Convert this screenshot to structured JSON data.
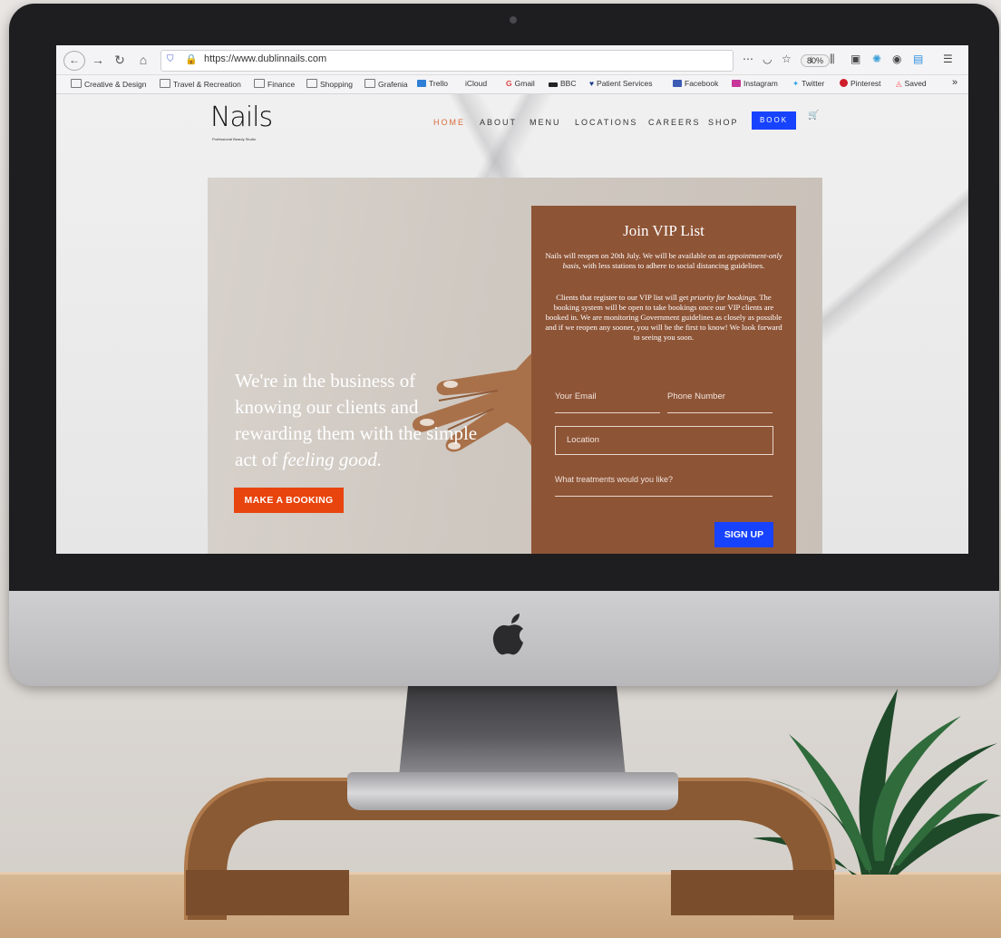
{
  "browser": {
    "url": "https://www.dublinnails.com",
    "zoom": "80%",
    "bookmarks": [
      "Creative & Design",
      "Travel & Recreation",
      "Finance",
      "Shopping",
      "Grafenia",
      "Trello",
      "iCloud",
      "Gmail",
      "BBC",
      "Patient Services",
      "Facebook",
      "Instagram",
      "Twitter",
      "Pinterest",
      "Saved"
    ]
  },
  "site": {
    "logo": "Nails",
    "logo_tagline": "Professional Beauty Studio",
    "nav": [
      "HOME",
      "ABOUT",
      "MENU",
      "LOCATIONS",
      "CAREERS",
      "SHOP"
    ],
    "book_label": "BOOK",
    "hero": {
      "headline_1": "We're in the business of knowing our clients and rewarding them with the simple act of",
      "headline_emph": "feeling good.",
      "cta": "MAKE A BOOKING"
    },
    "vip": {
      "title": "Join VIP List",
      "p1_a": "Nails will reopen on 20th July. We will be available on an",
      "p1_emph": "appointment-only basis,",
      "p1_b": "with less stations to adhere to social distancing guidelines.",
      "p2_a": "Clients that register to our VIP list will get",
      "p2_emph": "priority for bookings.",
      "p2_b": "The booking system will be open to take bookings once our VIP clients are booked in. We are monitoring Government guidelines as closely as possible and if we reopen any sooner, you will be the first to know! We look forward to seeing you soon.",
      "email_placeholder": "Your Email",
      "phone_placeholder": "Phone Number",
      "location_placeholder": "Location",
      "treatments_placeholder": "What treatments would you like?",
      "signup": "SIGN UP"
    }
  },
  "colors": {
    "accent_orange": "#e8440d",
    "accent_blue": "#1743ff",
    "vip_brown": "#8e5436",
    "nav_active": "#d86b3c"
  }
}
